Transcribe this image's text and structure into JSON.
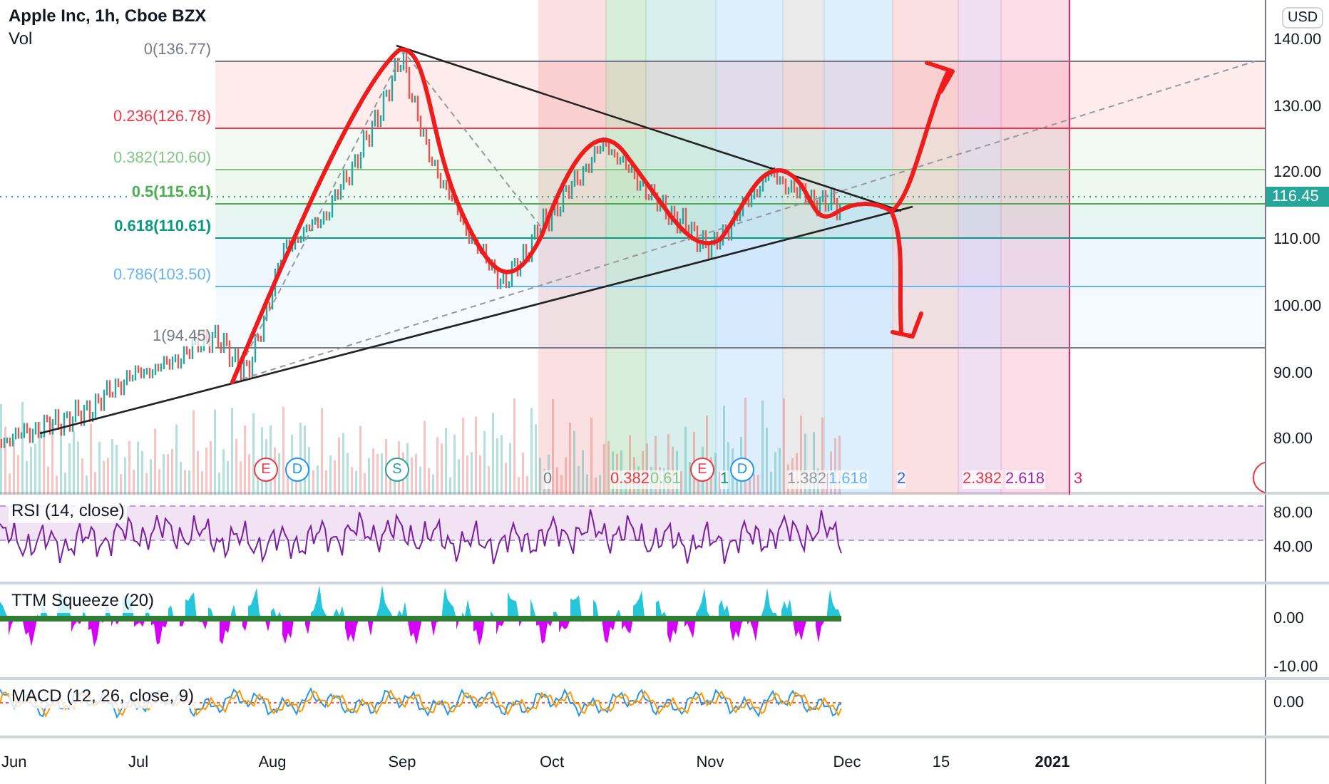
{
  "header": {
    "title": "Apple Inc, 1h, Cboe BZX",
    "volume_label": "Vol"
  },
  "currency": "USD",
  "price_axis": {
    "ticks": [
      "140.00",
      "130.00",
      "120.00",
      "110.00",
      "100.00",
      "90.00",
      "80.00"
    ],
    "last_price": "116.45"
  },
  "fib_levels": [
    {
      "label": "0(136.77)",
      "color": "#787b86"
    },
    {
      "label": "0.236(126.78)",
      "color": "#f23645"
    },
    {
      "label": "0.382(120.60)",
      "color": "#81c784"
    },
    {
      "label": "0.5(115.61)",
      "color": "#4caf50"
    },
    {
      "label": "0.618(110.61)",
      "color": "#089981"
    },
    {
      "label": "0.786(103.50)",
      "color": "#64b5f6"
    },
    {
      "label": "1(94.45)",
      "color": "#787b86"
    }
  ],
  "time_fib_labels": [
    {
      "label": "0",
      "color": "#787b86"
    },
    {
      "label": "0.382",
      "color": "#f23645"
    },
    {
      "label": "0.61",
      "color": "#81c784"
    },
    {
      "label": "1",
      "color": "#089981"
    },
    {
      "label": "1.382",
      "color": "#9598a1"
    },
    {
      "label": "1.618",
      "color": "#64b5f6"
    },
    {
      "label": "2",
      "color": "#2962ff"
    },
    {
      "label": "2.382",
      "color": "#f23645"
    },
    {
      "label": "2.618",
      "color": "#9c27b0"
    },
    {
      "label": "3",
      "color": "#e91e63"
    }
  ],
  "event_markers": [
    {
      "label": "E",
      "color": "#f23645"
    },
    {
      "label": "D",
      "color": "#2196f3"
    },
    {
      "label": "S",
      "color": "#26a69a"
    },
    {
      "label": "E",
      "color": "#f23645"
    },
    {
      "label": "D",
      "color": "#2196f3"
    }
  ],
  "indicators": [
    {
      "kind": "rsi",
      "title": "RSI (14, close)",
      "ticks": [
        "80.00",
        "40.00"
      ]
    },
    {
      "kind": "ttm",
      "title": "TTM Squeeze (20)",
      "ticks": [
        "0.00",
        "-10.00"
      ]
    },
    {
      "kind": "macd",
      "title": "MACD (12, 26, close, 9)",
      "ticks": [
        "0.00"
      ]
    }
  ],
  "time_axis": [
    {
      "label": "Jun",
      "bold": false
    },
    {
      "label": "Jul",
      "bold": false
    },
    {
      "label": "Aug",
      "bold": false
    },
    {
      "label": "Sep",
      "bold": false
    },
    {
      "label": "Oct",
      "bold": false
    },
    {
      "label": "Nov",
      "bold": false
    },
    {
      "label": "Dec",
      "bold": false
    },
    {
      "label": "15",
      "bold": false
    },
    {
      "label": "2021",
      "bold": true
    }
  ]
}
